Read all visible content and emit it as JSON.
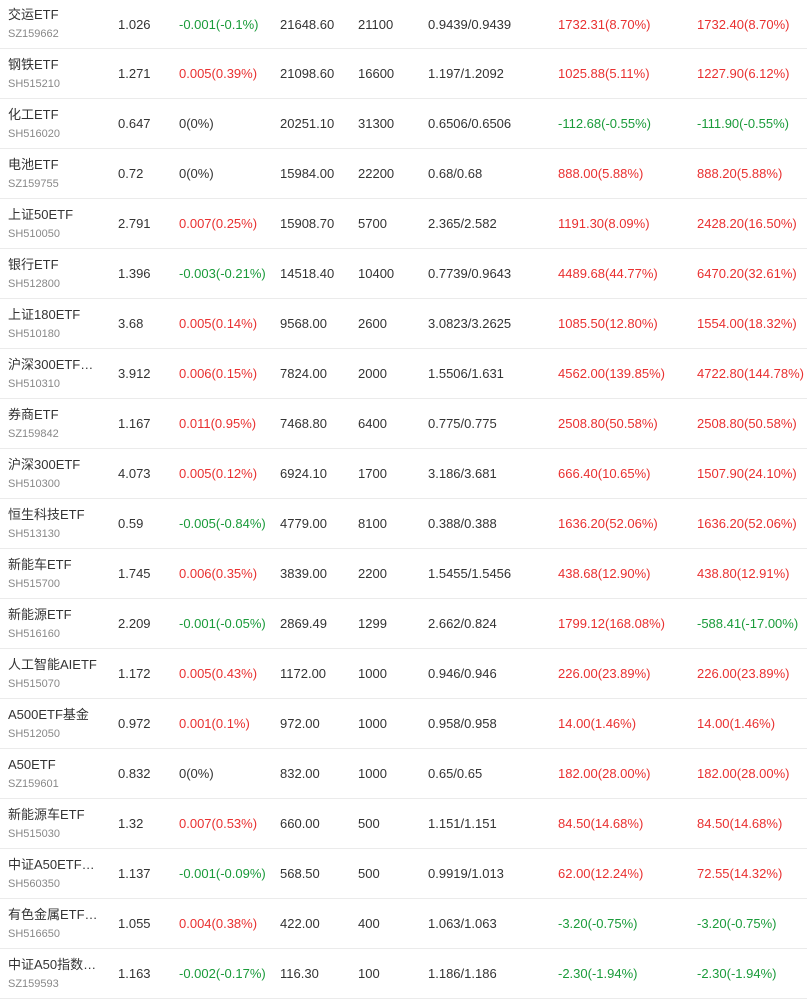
{
  "colors": {
    "up": "#e93030",
    "down": "#1a9b3a",
    "flat": "#333333"
  },
  "rows": [
    {
      "name": "交运ETF",
      "code": "SZ159662",
      "price": "1.026",
      "change": "-0.001(-0.1%)",
      "change_dir": "down",
      "value": "21648.60",
      "shares": "21100",
      "cost": "0.9439/0.9439",
      "pl1": "1732.31(8.70%)",
      "pl1_dir": "up",
      "pl2": "1732.40(8.70%)",
      "pl2_dir": "up"
    },
    {
      "name": "钢铁ETF",
      "code": "SH515210",
      "price": "1.271",
      "change": "0.005(0.39%)",
      "change_dir": "up",
      "value": "21098.60",
      "shares": "16600",
      "cost": "1.197/1.2092",
      "pl1": "1025.88(5.11%)",
      "pl1_dir": "up",
      "pl2": "1227.90(6.12%)",
      "pl2_dir": "up"
    },
    {
      "name": "化工ETF",
      "code": "SH516020",
      "price": "0.647",
      "change": "0(0%)",
      "change_dir": "flat",
      "value": "20251.10",
      "shares": "31300",
      "cost": "0.6506/0.6506",
      "pl1": "-112.68(-0.55%)",
      "pl1_dir": "down",
      "pl2": "-111.90(-0.55%)",
      "pl2_dir": "down"
    },
    {
      "name": "电池ETF",
      "code": "SZ159755",
      "price": "0.72",
      "change": "0(0%)",
      "change_dir": "flat",
      "value": "15984.00",
      "shares": "22200",
      "cost": "0.68/0.68",
      "pl1": "888.00(5.88%)",
      "pl1_dir": "up",
      "pl2": "888.20(5.88%)",
      "pl2_dir": "up"
    },
    {
      "name": "上证50ETF",
      "code": "SH510050",
      "price": "2.791",
      "change": "0.007(0.25%)",
      "change_dir": "up",
      "value": "15908.70",
      "shares": "5700",
      "cost": "2.365/2.582",
      "pl1": "1191.30(8.09%)",
      "pl1_dir": "up",
      "pl2": "2428.20(16.50%)",
      "pl2_dir": "up"
    },
    {
      "name": "银行ETF",
      "code": "SH512800",
      "price": "1.396",
      "change": "-0.003(-0.21%)",
      "change_dir": "down",
      "value": "14518.40",
      "shares": "10400",
      "cost": "0.7739/0.9643",
      "pl1": "4489.68(44.77%)",
      "pl1_dir": "up",
      "pl2": "6470.20(32.61%)",
      "pl2_dir": "up"
    },
    {
      "name": "上证180ETF",
      "code": "SH510180",
      "price": "3.68",
      "change": "0.005(0.14%)",
      "change_dir": "up",
      "value": "9568.00",
      "shares": "2600",
      "cost": "3.0823/3.2625",
      "pl1": "1085.50(12.80%)",
      "pl1_dir": "up",
      "pl2": "1554.00(18.32%)",
      "pl2_dir": "up"
    },
    {
      "name": "沪深300ETF…",
      "code": "SH510310",
      "price": "3.912",
      "change": "0.006(0.15%)",
      "change_dir": "up",
      "value": "7824.00",
      "shares": "2000",
      "cost": "1.5506/1.631",
      "pl1": "4562.00(139.85%)",
      "pl1_dir": "up",
      "pl2": "4722.80(144.78%)",
      "pl2_dir": "up"
    },
    {
      "name": "券商ETF",
      "code": "SZ159842",
      "price": "1.167",
      "change": "0.011(0.95%)",
      "change_dir": "up",
      "value": "7468.80",
      "shares": "6400",
      "cost": "0.775/0.775",
      "pl1": "2508.80(50.58%)",
      "pl1_dir": "up",
      "pl2": "2508.80(50.58%)",
      "pl2_dir": "up"
    },
    {
      "name": "沪深300ETF",
      "code": "SH510300",
      "price": "4.073",
      "change": "0.005(0.12%)",
      "change_dir": "up",
      "value": "6924.10",
      "shares": "1700",
      "cost": "3.186/3.681",
      "pl1": "666.40(10.65%)",
      "pl1_dir": "up",
      "pl2": "1507.90(24.10%)",
      "pl2_dir": "up"
    },
    {
      "name": "恒生科技ETF",
      "code": "SH513130",
      "price": "0.59",
      "change": "-0.005(-0.84%)",
      "change_dir": "down",
      "value": "4779.00",
      "shares": "8100",
      "cost": "0.388/0.388",
      "pl1": "1636.20(52.06%)",
      "pl1_dir": "up",
      "pl2": "1636.20(52.06%)",
      "pl2_dir": "up"
    },
    {
      "name": "新能车ETF",
      "code": "SH515700",
      "price": "1.745",
      "change": "0.006(0.35%)",
      "change_dir": "up",
      "value": "3839.00",
      "shares": "2200",
      "cost": "1.5455/1.5456",
      "pl1": "438.68(12.90%)",
      "pl1_dir": "up",
      "pl2": "438.80(12.91%)",
      "pl2_dir": "up"
    },
    {
      "name": "新能源ETF",
      "code": "SH516160",
      "price": "2.209",
      "change": "-0.001(-0.05%)",
      "change_dir": "down",
      "value": "2869.49",
      "shares": "1299",
      "cost": "2.662/0.824",
      "pl1": "1799.12(168.08%)",
      "pl1_dir": "up",
      "pl2": "-588.41(-17.00%)",
      "pl2_dir": "down"
    },
    {
      "name": "人工智能AIETF",
      "code": "SH515070",
      "price": "1.172",
      "change": "0.005(0.43%)",
      "change_dir": "up",
      "value": "1172.00",
      "shares": "1000",
      "cost": "0.946/0.946",
      "pl1": "226.00(23.89%)",
      "pl1_dir": "up",
      "pl2": "226.00(23.89%)",
      "pl2_dir": "up"
    },
    {
      "name": "A500ETF基金",
      "code": "SH512050",
      "price": "0.972",
      "change": "0.001(0.1%)",
      "change_dir": "up",
      "value": "972.00",
      "shares": "1000",
      "cost": "0.958/0.958",
      "pl1": "14.00(1.46%)",
      "pl1_dir": "up",
      "pl2": "14.00(1.46%)",
      "pl2_dir": "up"
    },
    {
      "name": "A50ETF",
      "code": "SZ159601",
      "price": "0.832",
      "change": "0(0%)",
      "change_dir": "flat",
      "value": "832.00",
      "shares": "1000",
      "cost": "0.65/0.65",
      "pl1": "182.00(28.00%)",
      "pl1_dir": "up",
      "pl2": "182.00(28.00%)",
      "pl2_dir": "up"
    },
    {
      "name": "新能源车ETF",
      "code": "SH515030",
      "price": "1.32",
      "change": "0.007(0.53%)",
      "change_dir": "up",
      "value": "660.00",
      "shares": "500",
      "cost": "1.151/1.151",
      "pl1": "84.50(14.68%)",
      "pl1_dir": "up",
      "pl2": "84.50(14.68%)",
      "pl2_dir": "up"
    },
    {
      "name": "中证A50ETF…",
      "code": "SH560350",
      "price": "1.137",
      "change": "-0.001(-0.09%)",
      "change_dir": "down",
      "value": "568.50",
      "shares": "500",
      "cost": "0.9919/1.013",
      "pl1": "62.00(12.24%)",
      "pl1_dir": "up",
      "pl2": "72.55(14.32%)",
      "pl2_dir": "up"
    },
    {
      "name": "有色金属ETF…",
      "code": "SH516650",
      "price": "1.055",
      "change": "0.004(0.38%)",
      "change_dir": "up",
      "value": "422.00",
      "shares": "400",
      "cost": "1.063/1.063",
      "pl1": "-3.20(-0.75%)",
      "pl1_dir": "down",
      "pl2": "-3.20(-0.75%)",
      "pl2_dir": "down"
    },
    {
      "name": "中证A50指数…",
      "code": "SZ159593",
      "price": "1.163",
      "change": "-0.002(-0.17%)",
      "change_dir": "down",
      "value": "116.30",
      "shares": "100",
      "cost": "1.186/1.186",
      "pl1": "-2.30(-1.94%)",
      "pl1_dir": "down",
      "pl2": "-2.30(-1.94%)",
      "pl2_dir": "down"
    }
  ]
}
